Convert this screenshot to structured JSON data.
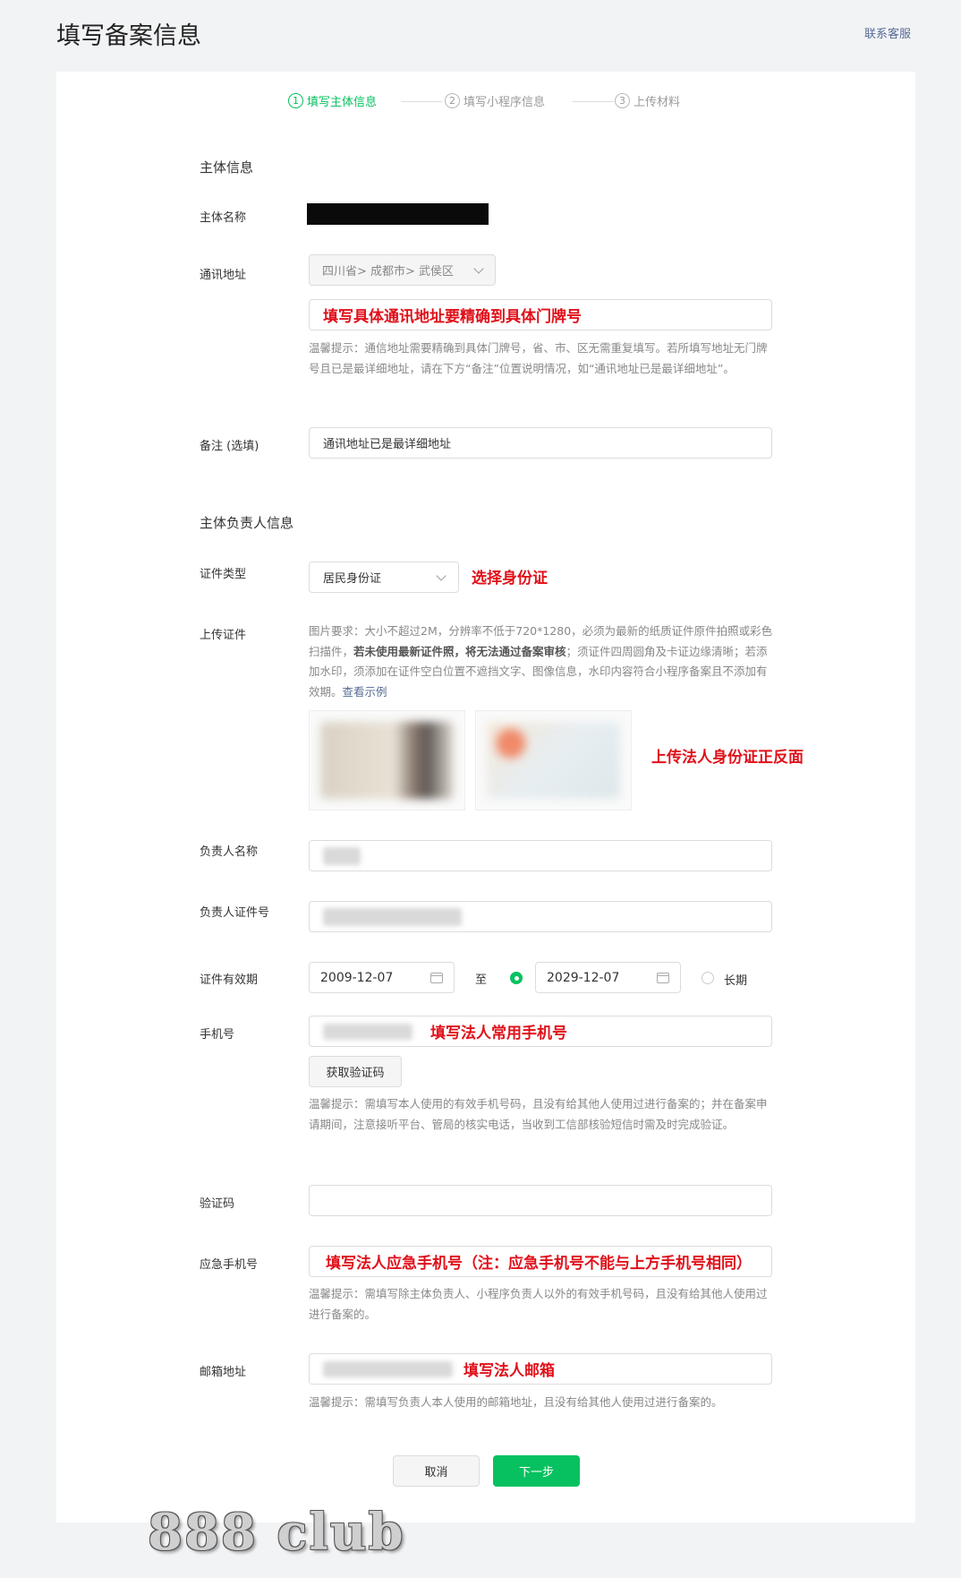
{
  "header": {
    "title": "填写备案信息",
    "contact": "联系客服"
  },
  "steps": [
    {
      "num": "1",
      "label": "填写主体信息"
    },
    {
      "num": "2",
      "label": "填写小程序信息"
    },
    {
      "num": "3",
      "label": "上传材料"
    }
  ],
  "subject": {
    "section_title": "主体信息",
    "name_label": "主体名称",
    "address_label": "通讯地址",
    "region_select": "四川省> 成都市> 武侯区",
    "address_annotation": "填写具体通讯地址要精确到具体门牌号",
    "address_hint": "温馨提示：通信地址需要精确到具体门牌号，省、市、区无需重复填写。若所填写地址无门牌号且已是最详细地址，请在下方“备注”位置说明情况，如“通讯地址已是最详细地址”。",
    "remark_label": "备注 (选填)",
    "remark_value": "通讯地址已是最详细地址"
  },
  "person": {
    "section_title": "主体负责人信息",
    "id_type_label": "证件类型",
    "id_type_value": "居民身份证",
    "id_type_annotation": "选择身份证",
    "upload_label": "上传证件",
    "upload_hint_1": "图片要求：大小不超过2M，分辨率不低于720*1280，必须为最新的纸质证件原件拍照或彩色扫描件，",
    "upload_hint_bold": "若未使用最新证件照，将无法通过备案审核",
    "upload_hint_2": "；须证件四周圆角及卡证边缘清晰；若添加水印，须添加在证件空白位置不遮挡文字、图像信息，水印内容符合小程序备案且不添加有效期。",
    "upload_hint_link": "查看示例",
    "upload_annotation": "上传法人身份证正反面",
    "name_label": "负责人名称",
    "id_number_label": "负责人证件号",
    "validity_label": "证件有效期",
    "validity_start": "2009-12-07",
    "validity_to": "至",
    "validity_end": "2029-12-07",
    "validity_long": "长期",
    "phone_label": "手机号",
    "phone_annotation": "填写法人常用手机号",
    "get_code_button": "获取验证码",
    "phone_hint": "温馨提示：需填写本人使用的有效手机号码，且没有给其他人使用过进行备案的；并在备案申请期间，注意接听平台、管局的核实电话，当收到工信部核验短信时需及时完成验证。",
    "code_label": "验证码",
    "emergency_label": "应急手机号",
    "emergency_annotation": "填写法人应急手机号（注：应急手机号不能与上方手机号相同）",
    "emergency_hint": "温馨提示：需填写除主体负责人、小程序负责人以外的有效手机号码，且没有给其他人使用过进行备案的。",
    "email_label": "邮箱地址",
    "email_annotation": "填写法人邮箱",
    "email_hint": "温馨提示：需填写负责人本人使用的邮箱地址，且没有给其他人使用过进行备案的。"
  },
  "footer": {
    "cancel": "取消",
    "next": "下一步"
  },
  "watermark": "888 club"
}
